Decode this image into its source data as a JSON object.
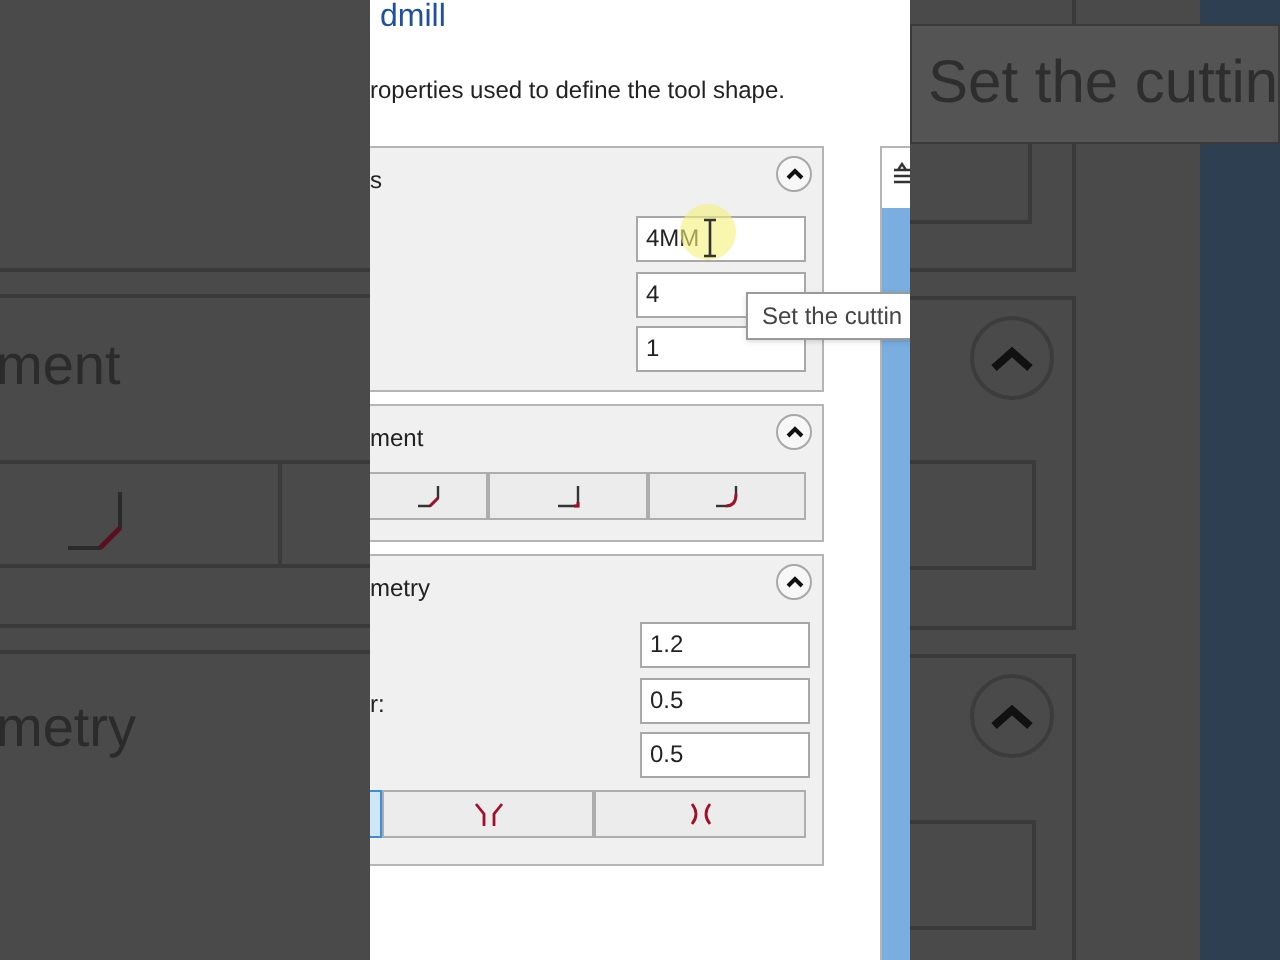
{
  "backdrop_left": {
    "texts": [
      "ment",
      "metry"
    ]
  },
  "backdrop_right": {
    "tooltip": "Set the cuttin"
  },
  "dialog": {
    "title": "dmill",
    "description": "roperties used to define the tool shape.",
    "groups": [
      {
        "heading": "s",
        "expanded": true,
        "fields": [
          {
            "value": "4MM",
            "hovered": true
          },
          {
            "value": "4",
            "hovered": false
          },
          {
            "value": "1",
            "hovered": false
          }
        ]
      },
      {
        "heading": "ment",
        "expanded": true,
        "buttons": [
          {
            "kind": "chamfer",
            "selected": false
          },
          {
            "kind": "sharp",
            "selected": false
          },
          {
            "kind": "round",
            "selected": false
          }
        ]
      },
      {
        "heading": "metry",
        "expanded": true,
        "fields": [
          {
            "value": "1.2",
            "hovered": false
          },
          {
            "label": "r:",
            "value": "0.5",
            "hovered": false
          },
          {
            "value": "0.5",
            "hovered": false
          }
        ],
        "buttons": [
          {
            "kind": "blank",
            "selected": true
          },
          {
            "kind": "taper",
            "selected": false
          },
          {
            "kind": "neck",
            "selected": false
          }
        ]
      }
    ],
    "tooltip": "Set the cuttin"
  }
}
